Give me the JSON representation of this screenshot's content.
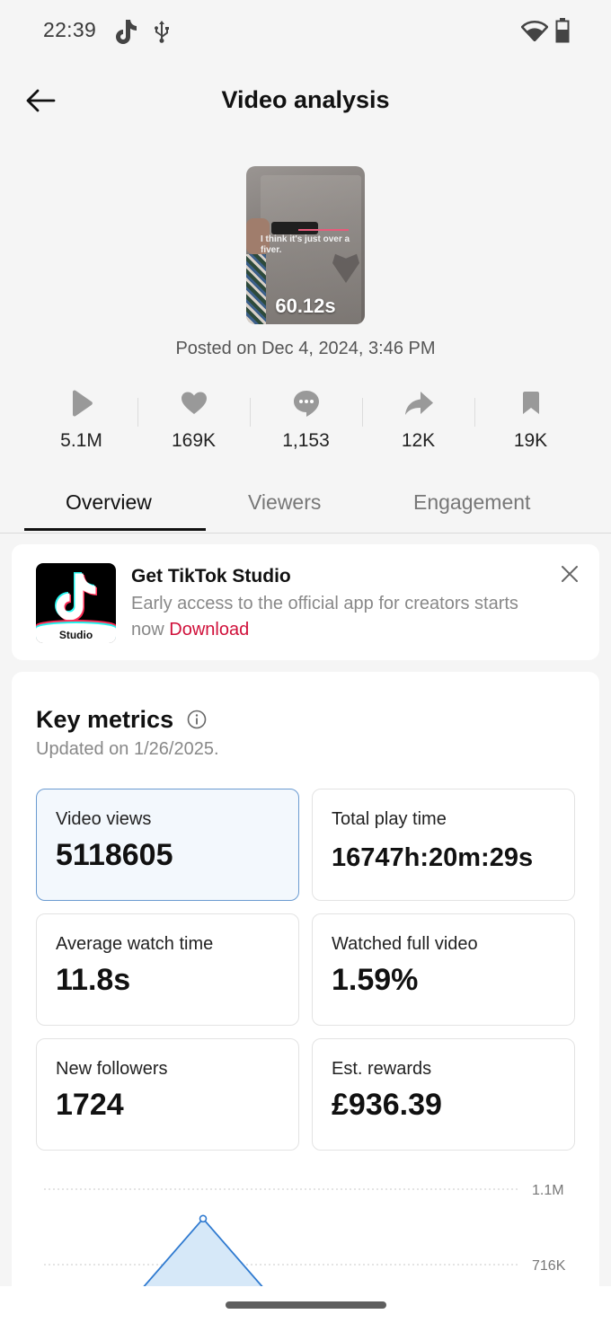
{
  "status_bar": {
    "time": "22:39",
    "left_icons": [
      "tiktok-notification-icon",
      "usb-icon"
    ],
    "right_icons": [
      "wifi-icon",
      "battery-icon"
    ]
  },
  "header": {
    "back_icon": "arrow-left-icon",
    "title": "Video analysis"
  },
  "video": {
    "thumbnail_caption": "I think it's just over a fiver.",
    "duration": "60.12s",
    "posted": "Posted on Dec 4, 2024, 3:46 PM"
  },
  "stats": [
    {
      "icon": "play-icon",
      "value": "5.1M"
    },
    {
      "icon": "heart-icon",
      "value": "169K"
    },
    {
      "icon": "comment-icon",
      "value": "1,153"
    },
    {
      "icon": "share-icon",
      "value": "12K"
    },
    {
      "icon": "bookmark-icon",
      "value": "19K"
    }
  ],
  "tabs": [
    {
      "label": "Overview",
      "active": true
    },
    {
      "label": "Viewers",
      "active": false
    },
    {
      "label": "Engagement",
      "active": false
    }
  ],
  "promo": {
    "logo_label": "Studio",
    "title": "Get TikTok Studio",
    "description": "Early access to the official app for creators starts now",
    "link": "Download",
    "link_color": "#d0103a"
  },
  "key_metrics": {
    "title": "Key metrics",
    "updated": "Updated on 1/26/2025.",
    "cards": [
      {
        "label": "Video views",
        "value": "5118605",
        "selected": true
      },
      {
        "label": "Total play time",
        "value": "16747h:20m:29s",
        "selected": false
      },
      {
        "label": "Average watch time",
        "value": "11.8s",
        "selected": false
      },
      {
        "label": "Watched full video",
        "value": "1.59%",
        "selected": false
      },
      {
        "label": "New followers",
        "value": "1724",
        "selected": false
      },
      {
        "label": "Est. rewards",
        "value": "£936.39",
        "selected": false
      }
    ]
  },
  "chart_data": {
    "type": "area",
    "series": [
      {
        "name": "Video views",
        "values": [
          null,
          950000,
          null
        ]
      }
    ],
    "y_ticks": [
      "1.1M",
      "716K"
    ],
    "y_tick_values": [
      1100000,
      716000
    ],
    "ylim": [
      600000,
      1100000
    ],
    "grid": true,
    "line_color": "#2f7ad0",
    "fill_color": "#d6e8f8",
    "note": "chart partially cropped at bottom of screen"
  }
}
